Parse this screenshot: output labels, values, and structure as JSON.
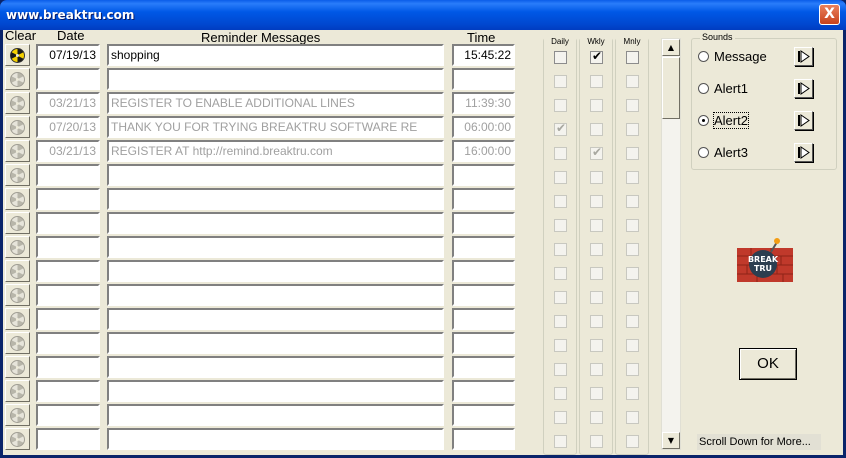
{
  "window": {
    "title": "www.breaktru.com",
    "close_label": "X"
  },
  "headers": {
    "clear": "Clear",
    "date": "Date",
    "messages": "Reminder Messages",
    "time": "Time"
  },
  "checkbox_headers": {
    "daily": "Daily",
    "weekly": "Wkly",
    "monthly": "Mnly"
  },
  "rows": [
    {
      "date": "07/19/13",
      "message": "shopping",
      "time": "15:45:22",
      "active": true,
      "daily": false,
      "weekly": true,
      "monthly": false
    },
    {
      "date": "",
      "message": "",
      "time": "",
      "active": false,
      "daily": false,
      "weekly": false,
      "monthly": false
    },
    {
      "date": "03/21/13",
      "message": "REGISTER TO ENABLE ADDITIONAL LINES",
      "time": "11:39:30",
      "active": false,
      "daily": false,
      "weekly": false,
      "monthly": false
    },
    {
      "date": "07/20/13",
      "message": "THANK YOU FOR TRYING BREAKTRU SOFTWARE RE",
      "time": "06:00:00",
      "active": false,
      "daily": true,
      "weekly": false,
      "monthly": false
    },
    {
      "date": "03/21/13",
      "message": "REGISTER AT http://remind.breaktru.com",
      "time": "16:00:00",
      "active": false,
      "daily": false,
      "weekly": true,
      "monthly": false
    },
    {
      "date": "",
      "message": "",
      "time": "",
      "active": false,
      "daily": false,
      "weekly": false,
      "monthly": false
    },
    {
      "date": "",
      "message": "",
      "time": "",
      "active": false,
      "daily": false,
      "weekly": false,
      "monthly": false
    },
    {
      "date": "",
      "message": "",
      "time": "",
      "active": false,
      "daily": false,
      "weekly": false,
      "monthly": false
    },
    {
      "date": "",
      "message": "",
      "time": "",
      "active": false,
      "daily": false,
      "weekly": false,
      "monthly": false
    },
    {
      "date": "",
      "message": "",
      "time": "",
      "active": false,
      "daily": false,
      "weekly": false,
      "monthly": false
    },
    {
      "date": "",
      "message": "",
      "time": "",
      "active": false,
      "daily": false,
      "weekly": false,
      "monthly": false
    },
    {
      "date": "",
      "message": "",
      "time": "",
      "active": false,
      "daily": false,
      "weekly": false,
      "monthly": false
    },
    {
      "date": "",
      "message": "",
      "time": "",
      "active": false,
      "daily": false,
      "weekly": false,
      "monthly": false
    },
    {
      "date": "",
      "message": "",
      "time": "",
      "active": false,
      "daily": false,
      "weekly": false,
      "monthly": false
    },
    {
      "date": "",
      "message": "",
      "time": "",
      "active": false,
      "daily": false,
      "weekly": false,
      "monthly": false
    },
    {
      "date": "",
      "message": "",
      "time": "",
      "active": false,
      "daily": false,
      "weekly": false,
      "monthly": false
    },
    {
      "date": "",
      "message": "",
      "time": "",
      "active": false,
      "daily": false,
      "weekly": false,
      "monthly": false
    }
  ],
  "sounds": {
    "label": "Sounds",
    "options": [
      {
        "label": "Message",
        "selected": false
      },
      {
        "label": "Alert1",
        "selected": false
      },
      {
        "label": "Alert2",
        "selected": true
      },
      {
        "label": "Alert3",
        "selected": false
      }
    ]
  },
  "logo": {
    "text_top": "BREAK",
    "text_bottom": "TRU"
  },
  "ok_label": "OK",
  "scroll_hint": "Scroll Down for More...",
  "colors": {
    "titlebar": "#0058e6",
    "client": "#ece9d8",
    "gray_text": "#a0a0a0"
  }
}
